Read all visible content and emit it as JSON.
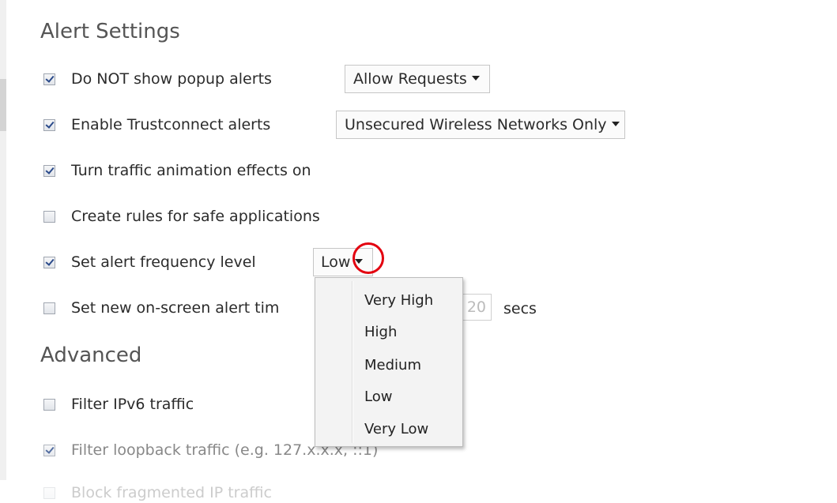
{
  "alert_settings": {
    "title": "Alert Settings",
    "do_not_show_popup": {
      "label": "Do NOT show popup alerts",
      "checked": true,
      "dropdown_value": "Allow Requests"
    },
    "enable_trustconnect": {
      "label": "Enable Trustconnect alerts",
      "checked": true,
      "dropdown_value": "Unsecured Wireless Networks Only"
    },
    "traffic_animation": {
      "label": "Turn traffic animation effects on",
      "checked": true
    },
    "create_rules": {
      "label": "Create rules for safe applications",
      "checked": false
    },
    "alert_frequency": {
      "label": "Set alert frequency level",
      "checked": true,
      "dropdown_value": "Low"
    },
    "alert_timeout": {
      "label": "Set new on-screen alert tim",
      "checked": false,
      "value": "20",
      "unit": "secs"
    }
  },
  "frequency_menu": {
    "options": [
      "Very High",
      "High",
      "Medium",
      "Low",
      "Very Low"
    ]
  },
  "advanced": {
    "title": "Advanced",
    "filter_ipv6": {
      "label": "Filter IPv6 traffic",
      "checked": false
    },
    "filter_loopback": {
      "label": "Filter loopback traffic (e.g. 127.x.x.x, ::1)",
      "checked": true
    },
    "block_fragmented": {
      "label": "Block fragmented IP traffic",
      "checked": false
    }
  },
  "colors": {
    "highlight_circle": "#e3000f",
    "menu_background": "#f3f3f3"
  }
}
